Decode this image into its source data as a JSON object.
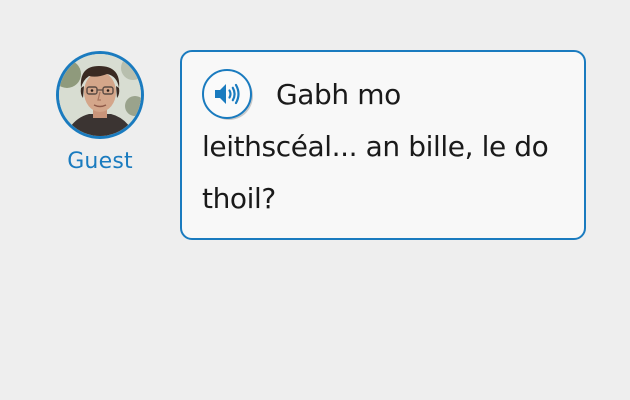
{
  "speaker": {
    "name": "Guest"
  },
  "message": {
    "text": "Gabh mo leithscéal... an bille, le do thoil?",
    "audio_icon": "speaker-volume-icon"
  },
  "colors": {
    "accent": "#1a7bbf",
    "background": "#eeeeee",
    "bubble_background": "#f8f8f8",
    "text": "#1a1a1a"
  }
}
